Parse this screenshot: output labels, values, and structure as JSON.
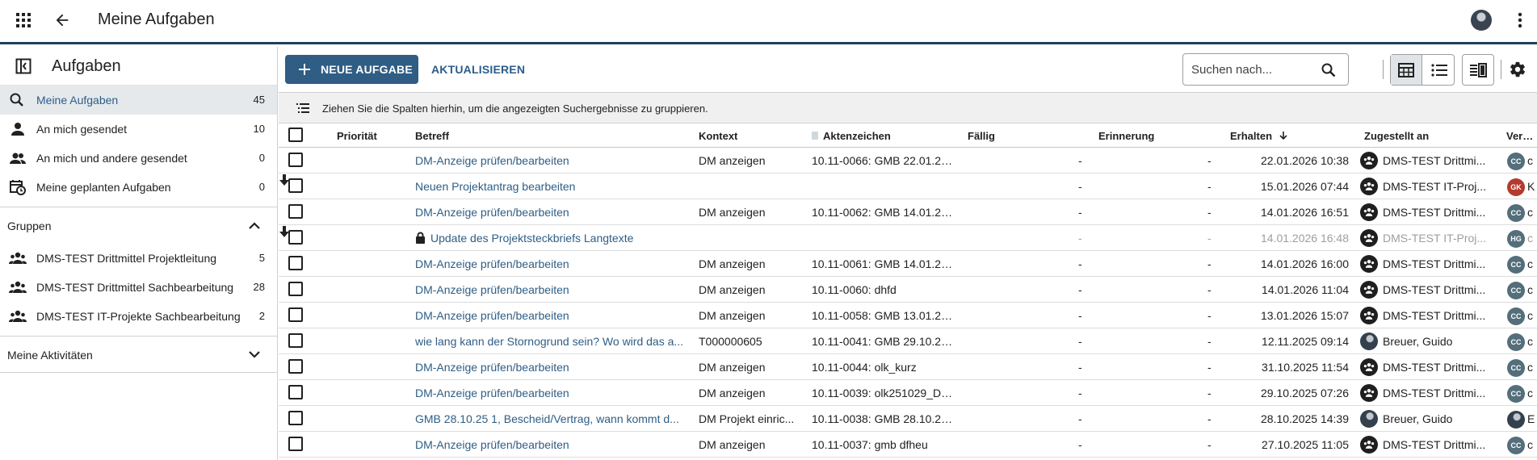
{
  "topbar": {
    "title": "Meine Aufgaben"
  },
  "sidebar": {
    "title": "Aufgaben",
    "items": [
      {
        "label": "Meine Aufgaben",
        "count": "45",
        "icon": "search-icon",
        "active": true
      },
      {
        "label": "An mich gesendet",
        "count": "10",
        "icon": "person-icon"
      },
      {
        "label": "An mich und andere gesendet",
        "count": "0",
        "icon": "people-icon"
      },
      {
        "label": "Meine geplanten Aufgaben",
        "count": "0",
        "icon": "calendar-clock-icon"
      }
    ],
    "groups_title": "Gruppen",
    "groups": [
      {
        "label": "DMS-TEST Drittmittel Projektleitung",
        "count": "5"
      },
      {
        "label": "DMS-TEST Drittmittel Sachbearbeitung",
        "count": "28"
      },
      {
        "label": "DMS-TEST IT-Projekte Sachbearbeitung",
        "count": "2"
      }
    ],
    "activities_title": "Meine Aktivitäten"
  },
  "toolbar": {
    "new_label": "NEUE AUFGABE",
    "refresh_label": "AKTUALISIEREN",
    "search_placeholder": "Suchen nach..."
  },
  "groupbar": {
    "text": "Ziehen Sie die Spalten hierhin, um die angezeigten Suchergebnisse zu gruppieren."
  },
  "columns": {
    "prio": "Priorität",
    "betreff": "Betreff",
    "kontext": "Kontext",
    "akten": "Aktenzeichen",
    "faellig": "Fällig",
    "erinnerung": "Erinnerung",
    "erhalten": "Erhalten",
    "zugestellt": "Zugestellt an",
    "versender": "Versen"
  },
  "rows": [
    {
      "prio": "",
      "betreff": "DM-Anzeige prüfen/bearbeiten",
      "kontext": "DM anzeigen",
      "akten": "10.11-0066: GMB 22.01.26...",
      "faellig": "-",
      "erinnerung": "-",
      "erhalten": "22.01.2026 10:38",
      "zugestellt": "DMS-TEST Drittmi...",
      "vers_initials": "CC",
      "vers_text": "c"
    },
    {
      "prio": "low",
      "betreff": "Neuen Projektantrag bearbeiten",
      "kontext": "",
      "akten": "",
      "faellig": "-",
      "erinnerung": "-",
      "erhalten": "15.01.2026 07:44",
      "zugestellt": "DMS-TEST IT-Proj...",
      "vers_initials": "GK",
      "vers_text": "K"
    },
    {
      "prio": "",
      "betreff": "DM-Anzeige prüfen/bearbeiten",
      "kontext": "DM anzeigen",
      "akten": "10.11-0062: GMB 14.01.20...",
      "faellig": "-",
      "erinnerung": "-",
      "erhalten": "14.01.2026 16:51",
      "zugestellt": "DMS-TEST Drittmi...",
      "vers_initials": "CC",
      "vers_text": "c"
    },
    {
      "prio": "low",
      "betreff": "Update des Projektsteckbriefs Langtexte",
      "kontext": "",
      "akten": "",
      "faellig": "-",
      "erinnerung": "-",
      "erhalten": "14.01.2026 16:48",
      "zugestellt": "DMS-TEST IT-Proj...",
      "vers_initials": "HG",
      "vers_text": "c",
      "locked": true,
      "dim": true
    },
    {
      "prio": "",
      "betreff": "DM-Anzeige prüfen/bearbeiten",
      "kontext": "DM anzeigen",
      "akten": "10.11-0061: GMB 14.01.20...",
      "faellig": "-",
      "erinnerung": "-",
      "erhalten": "14.01.2026 16:00",
      "zugestellt": "DMS-TEST Drittmi...",
      "vers_initials": "CC",
      "vers_text": "c"
    },
    {
      "prio": "",
      "betreff": "DM-Anzeige prüfen/bearbeiten",
      "kontext": "DM anzeigen",
      "akten": "10.11-0060: dhfd",
      "faellig": "-",
      "erinnerung": "-",
      "erhalten": "14.01.2026 11:04",
      "zugestellt": "DMS-TEST Drittmi...",
      "vers_initials": "CC",
      "vers_text": "c"
    },
    {
      "prio": "",
      "betreff": "DM-Anzeige prüfen/bearbeiten",
      "kontext": "DM anzeigen",
      "akten": "10.11-0058: GMB 13.01.20...",
      "faellig": "-",
      "erinnerung": "-",
      "erhalten": "13.01.2026 15:07",
      "zugestellt": "DMS-TEST Drittmi...",
      "vers_initials": "CC",
      "vers_text": "c"
    },
    {
      "prio": "",
      "betreff": "wie lang kann der Stornogrund sein? Wo wird das a...",
      "kontext": "T000000605",
      "akten": "10.11-0041: GMB 29.10.20...",
      "faellig": "-",
      "erinnerung": "-",
      "erhalten": "12.11.2025 09:14",
      "zugestellt": "Breuer, Guido",
      "zug_photo": true,
      "vers_initials": "CC",
      "vers_text": "c"
    },
    {
      "prio": "",
      "betreff": "DM-Anzeige prüfen/bearbeiten",
      "kontext": "DM anzeigen",
      "akten": "10.11-0044: olk_kurz",
      "faellig": "-",
      "erinnerung": "-",
      "erhalten": "31.10.2025 11:54",
      "zugestellt": "DMS-TEST Drittmi...",
      "vers_initials": "CC",
      "vers_text": "c"
    },
    {
      "prio": "",
      "betreff": "DM-Anzeige prüfen/bearbeiten",
      "kontext": "DM anzeigen",
      "akten": "10.11-0039: olk251029_DE...",
      "faellig": "-",
      "erinnerung": "-",
      "erhalten": "29.10.2025 07:26",
      "zugestellt": "DMS-TEST Drittmi...",
      "vers_initials": "CC",
      "vers_text": "c"
    },
    {
      "prio": "",
      "betreff": "GMB 28.10.25 1, Bescheid/Vertrag, wann kommt d...",
      "kontext": "DM Projekt einric...",
      "akten": "10.11-0038: GMB 28.10.20...",
      "faellig": "-",
      "erinnerung": "-",
      "erhalten": "28.10.2025 14:39",
      "zugestellt": "Breuer, Guido",
      "zug_photo": true,
      "vers_initials": "",
      "vers_text": "E",
      "vers_photo": true
    },
    {
      "prio": "",
      "betreff": "DM-Anzeige prüfen/bearbeiten",
      "kontext": "DM anzeigen",
      "akten": "10.11-0037: gmb dfheu",
      "faellig": "-",
      "erinnerung": "-",
      "erhalten": "27.10.2025 11:05",
      "zugestellt": "DMS-TEST Drittmi...",
      "vers_initials": "CC",
      "vers_text": "c"
    }
  ]
}
